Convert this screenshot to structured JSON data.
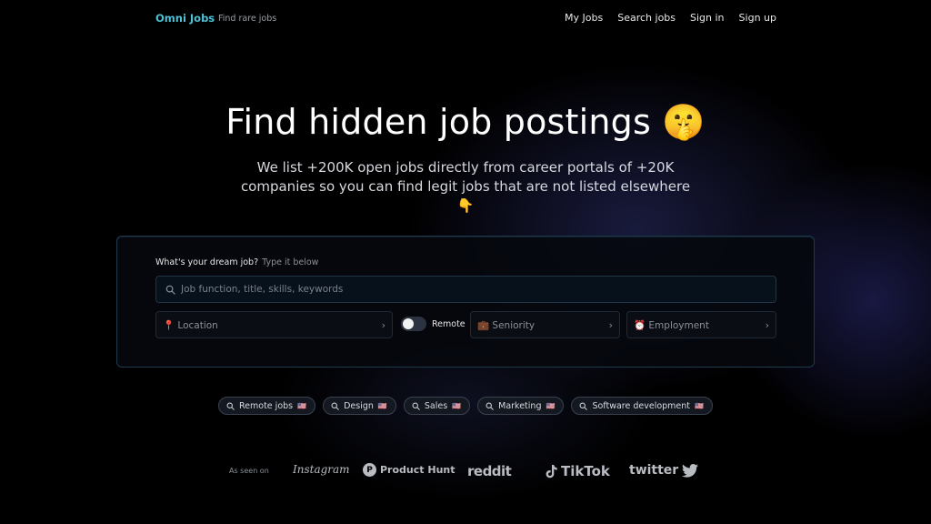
{
  "nav": {
    "brand": "Omni Jobs",
    "tagline": "Find rare jobs",
    "links": [
      "My Jobs",
      "Search jobs",
      "Sign in",
      "Sign up"
    ]
  },
  "hero": {
    "title": "Find hidden job postings 🤫",
    "subtitle": "We list +200K open jobs directly from career portals of +20K companies so you can find legit jobs that are not listed elsewhere 👇"
  },
  "search": {
    "label": "What's your dream job?",
    "hint": "Type it below",
    "placeholder": "Job function, title, skills, keywords"
  },
  "filters": {
    "location": "📍 Location",
    "remote_label": "Remote",
    "remote_on": false,
    "seniority": "💼 Seniority",
    "employment": "⏰ Employment"
  },
  "chips": [
    {
      "label": "Remote jobs",
      "flag": "🇺🇸"
    },
    {
      "label": "Design",
      "flag": "🇺🇸"
    },
    {
      "label": "Sales",
      "flag": "🇺🇸"
    },
    {
      "label": "Marketing",
      "flag": "🇺🇸"
    },
    {
      "label": "Software development",
      "flag": "🇺🇸"
    }
  ],
  "seen_on": {
    "label": "As seen on",
    "logos": [
      "Instagram",
      "Product Hunt",
      "reddit",
      "TikTok",
      "twitter"
    ],
    "ph_letter": "P"
  },
  "colors": {
    "brand": "#4fc1d6",
    "background": "#000000"
  }
}
